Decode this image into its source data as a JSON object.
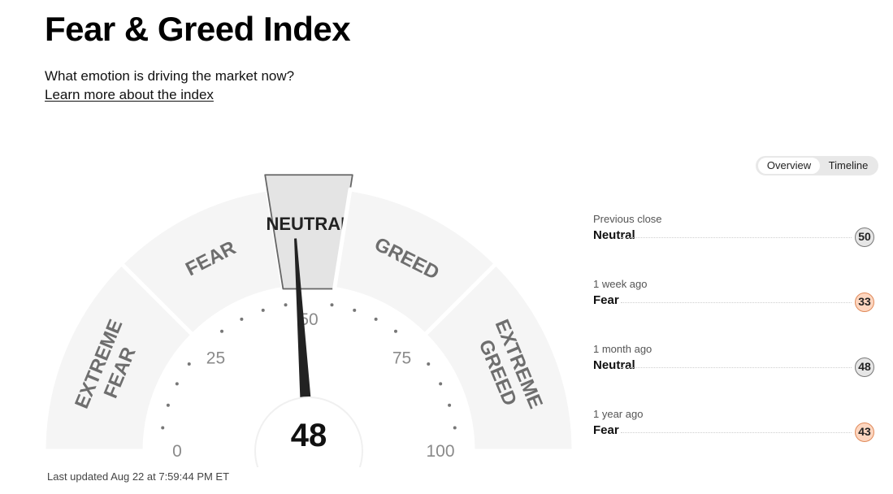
{
  "header": {
    "title": "Fear & Greed Index",
    "subtitle": "What emotion is driving the market now?",
    "learn_link": "Learn more about the index"
  },
  "view_toggle": {
    "options": [
      "Overview",
      "Timeline"
    ],
    "selected": "Overview"
  },
  "gauge": {
    "value": 48,
    "value_label": "48",
    "scale": {
      "min": 0,
      "max": 100
    },
    "tick_labels": [
      "0",
      "25",
      "50",
      "75",
      "100"
    ],
    "active_segment": "NEUTRAL",
    "segments": [
      {
        "lines": [
          "EXTREME",
          "FEAR"
        ],
        "range": [
          0,
          25
        ]
      },
      {
        "lines": [
          "FEAR"
        ],
        "range": [
          25,
          45
        ]
      },
      {
        "lines": [
          "NEUTRAL"
        ],
        "range": [
          45,
          55
        ]
      },
      {
        "lines": [
          "GREED"
        ],
        "range": [
          55,
          75
        ]
      },
      {
        "lines": [
          "EXTREME",
          "GREED"
        ],
        "range": [
          75,
          100
        ]
      }
    ]
  },
  "history": [
    {
      "label": "Previous close",
      "rating": "Neutral",
      "value": "50",
      "tone": "neutral"
    },
    {
      "label": "1 week ago",
      "rating": "Fear",
      "value": "33",
      "tone": "fear"
    },
    {
      "label": "1 month ago",
      "rating": "Neutral",
      "value": "48",
      "tone": "neutral"
    },
    {
      "label": "1 year ago",
      "rating": "Fear",
      "value": "43",
      "tone": "fear"
    }
  ],
  "colors": {
    "neutral_badge": "#e6e6e6",
    "fear_badge": "#fdd6c0",
    "fear_border": "#e08a5a",
    "neutral_border": "#777777",
    "segment_fill": "#f5f5f5",
    "active_fill": "#e4e4e4",
    "needle": "#222222"
  },
  "footer": {
    "last_updated": "Last updated Aug 22 at 7:59:44 PM ET"
  }
}
